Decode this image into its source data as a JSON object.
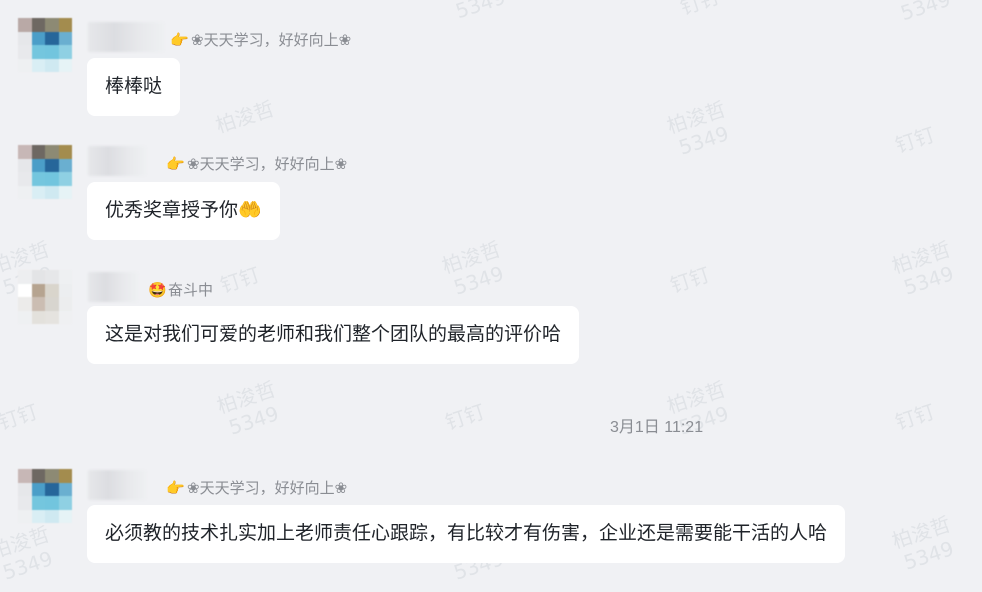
{
  "watermark": {
    "brand": "钉钉",
    "name": "柏浚哲",
    "code": "5349"
  },
  "messages": [
    {
      "status_icon": "pointing-hand-icon",
      "status_glyph": "👉",
      "status": "❀天天学习，好好向上❀",
      "text": "棒棒哒"
    },
    {
      "status_icon": "pointing-hand-icon",
      "status_glyph": "👉",
      "status": "❀天天学习，好好向上❀",
      "text": "优秀奖章授予你",
      "emoji": "🤲"
    },
    {
      "status_icon": "star-struck-face-icon",
      "status_glyph": "🤩",
      "status": "奋斗中",
      "text": "这是对我们可爱的老师和我们整个团队的最高的评价哈"
    },
    {
      "status_icon": "pointing-hand-icon",
      "status_glyph": "👉",
      "status": "❀天天学习，好好向上❀",
      "text": "必须教的技术扎实加上老师责任心跟踪，有比较才有伤害，企业还是需要能干活的人哈"
    }
  ],
  "timestamp": "3月1日 11:21"
}
